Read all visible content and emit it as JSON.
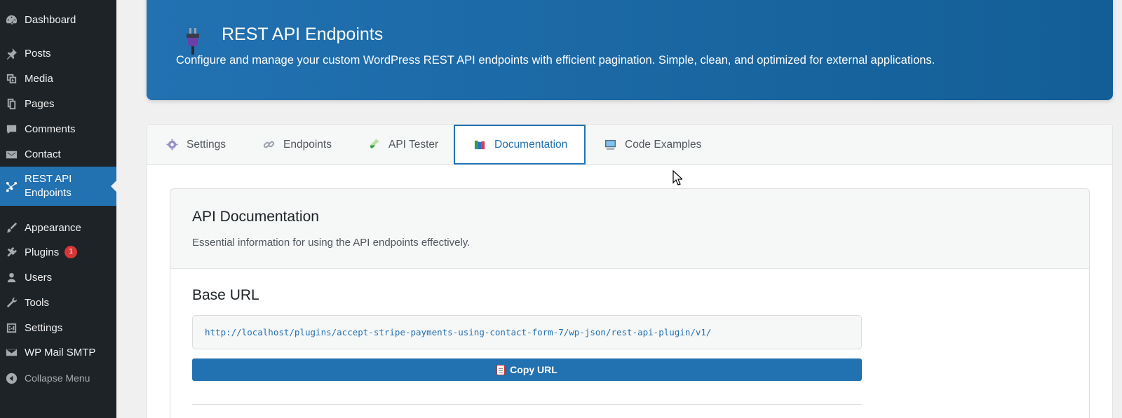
{
  "sidebar": {
    "items": [
      {
        "label": "Dashboard",
        "icon": "dashboard-icon"
      },
      {
        "label": "Posts",
        "icon": "pin-icon"
      },
      {
        "label": "Media",
        "icon": "media-icon"
      },
      {
        "label": "Pages",
        "icon": "pages-icon"
      },
      {
        "label": "Comments",
        "icon": "comments-icon"
      },
      {
        "label": "Contact",
        "icon": "mail-icon"
      },
      {
        "label": "REST API Endpoints",
        "label_line1": "REST API",
        "label_line2": "Endpoints",
        "icon": "api-icon",
        "active": true
      },
      {
        "label": "Appearance",
        "icon": "brush-icon"
      },
      {
        "label": "Plugins",
        "icon": "plugin-icon",
        "badge": "1"
      },
      {
        "label": "Users",
        "icon": "users-icon"
      },
      {
        "label": "Tools",
        "icon": "wrench-icon"
      },
      {
        "label": "Settings",
        "icon": "settings-icon"
      },
      {
        "label": "WP Mail SMTP",
        "icon": "mail-smtp-icon"
      },
      {
        "label": "Collapse Menu",
        "icon": "collapse-icon"
      }
    ]
  },
  "banner": {
    "title": "REST API Endpoints",
    "description": "Configure and manage your custom WordPress REST API endpoints with efficient pagination. Simple, clean, and optimized for external applications."
  },
  "tabs": [
    {
      "label": "Settings",
      "icon": "gear-icon"
    },
    {
      "label": "Endpoints",
      "icon": "link-icon"
    },
    {
      "label": "API Tester",
      "icon": "test-tube-icon"
    },
    {
      "label": "Documentation",
      "icon": "books-icon",
      "active": true
    },
    {
      "label": "Code Examples",
      "icon": "computer-icon"
    }
  ],
  "doc": {
    "title": "API Documentation",
    "subtitle": "Essential information for using the API endpoints effectively.",
    "base_url_title": "Base URL",
    "base_url": "http://localhost/plugins/accept-stripe-payments-using-contact-form-7/wp-json/rest-api-plugin/v1/",
    "copy_label": "Copy URL"
  },
  "colors": {
    "sidebar_bg": "#1d2327",
    "accent": "#2271b1",
    "badge": "#d63638"
  }
}
